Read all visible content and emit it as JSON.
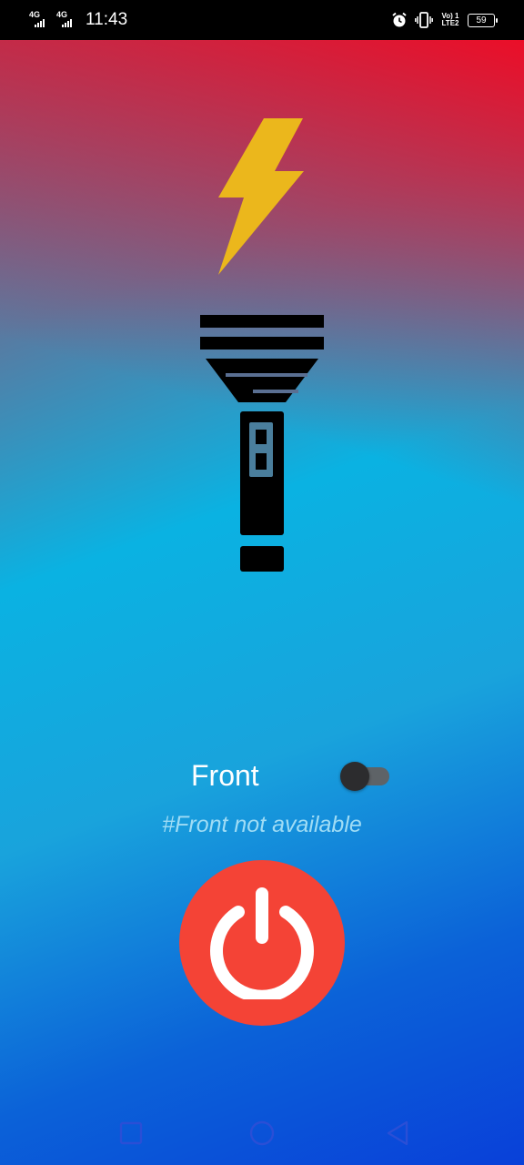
{
  "status_bar": {
    "signal_1_label": "4G",
    "signal_2_label": "4G",
    "time": "11:43",
    "alarm_icon": "alarm-icon",
    "vibrate_icon": "vibrate-icon",
    "volte_line1": "Vo) 1",
    "volte_line2": "LTE2",
    "battery_level": "59"
  },
  "main": {
    "gradient_colors": [
      "#eb0e28",
      "#7e5d80",
      "#0ab2e2",
      "#0940d9"
    ],
    "bolt_icon": "lightning-bolt-icon",
    "bolt_color": "#ebb71c",
    "torch_icon": "flashlight-icon",
    "front_label": "Front",
    "front_toggle_on": false,
    "note": "#Front not available",
    "power_icon": "power-icon",
    "power_color": "#f44336"
  },
  "nav_bar": {
    "recents_icon": "square-icon",
    "home_icon": "circle-icon",
    "back_icon": "triangle-back-icon"
  }
}
